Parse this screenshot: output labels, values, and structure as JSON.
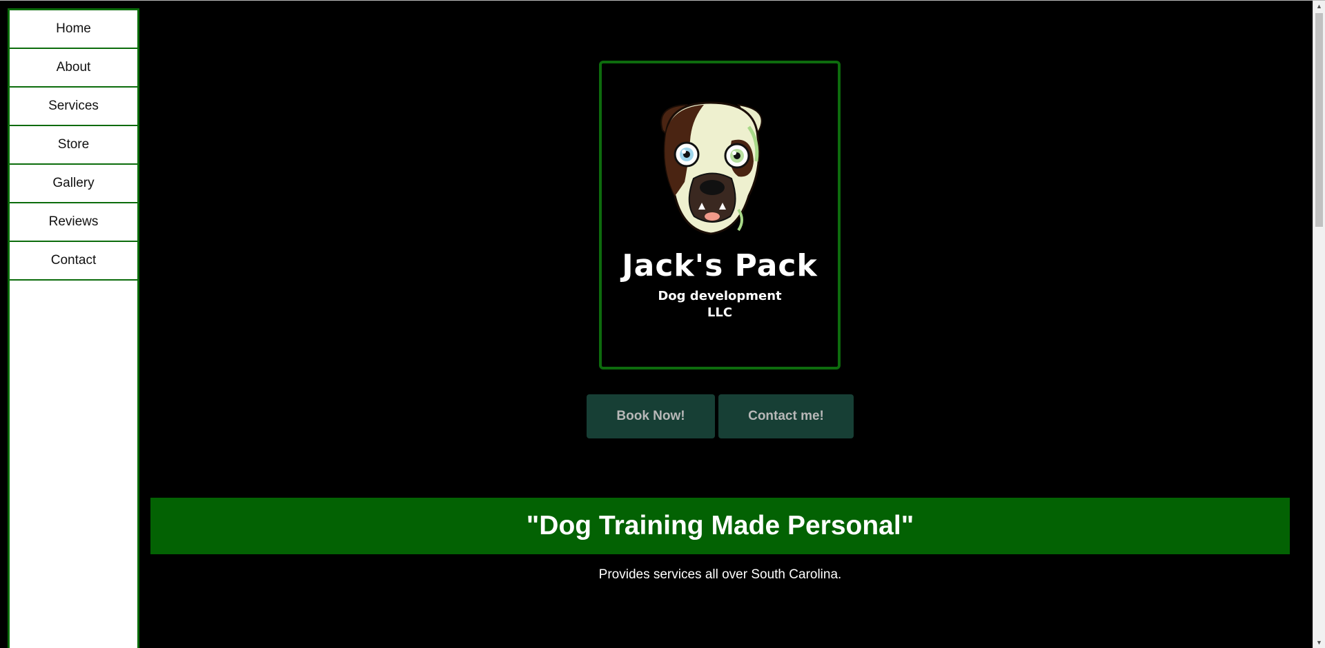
{
  "sidebar": {
    "items": [
      {
        "label": "Home"
      },
      {
        "label": "About"
      },
      {
        "label": "Services"
      },
      {
        "label": "Store"
      },
      {
        "label": "Gallery"
      },
      {
        "label": "Reviews"
      },
      {
        "label": "Contact"
      }
    ]
  },
  "logo": {
    "title": "Jack's Pack",
    "subtitle_line1": "Dog development",
    "subtitle_line2": "LLC",
    "icon": "bulldog-face-icon"
  },
  "buttons": {
    "book_label": "Book Now!",
    "contact_label": "Contact me!"
  },
  "banner": {
    "text": "\"Dog Training Made Personal\""
  },
  "tagline": {
    "text": "Provides services all over South Carolina."
  },
  "colors": {
    "brand_green": "#036203",
    "border_green": "#0a6b0a",
    "button_bg": "#173f35",
    "button_text": "#b8b8b8",
    "background": "#000000"
  }
}
